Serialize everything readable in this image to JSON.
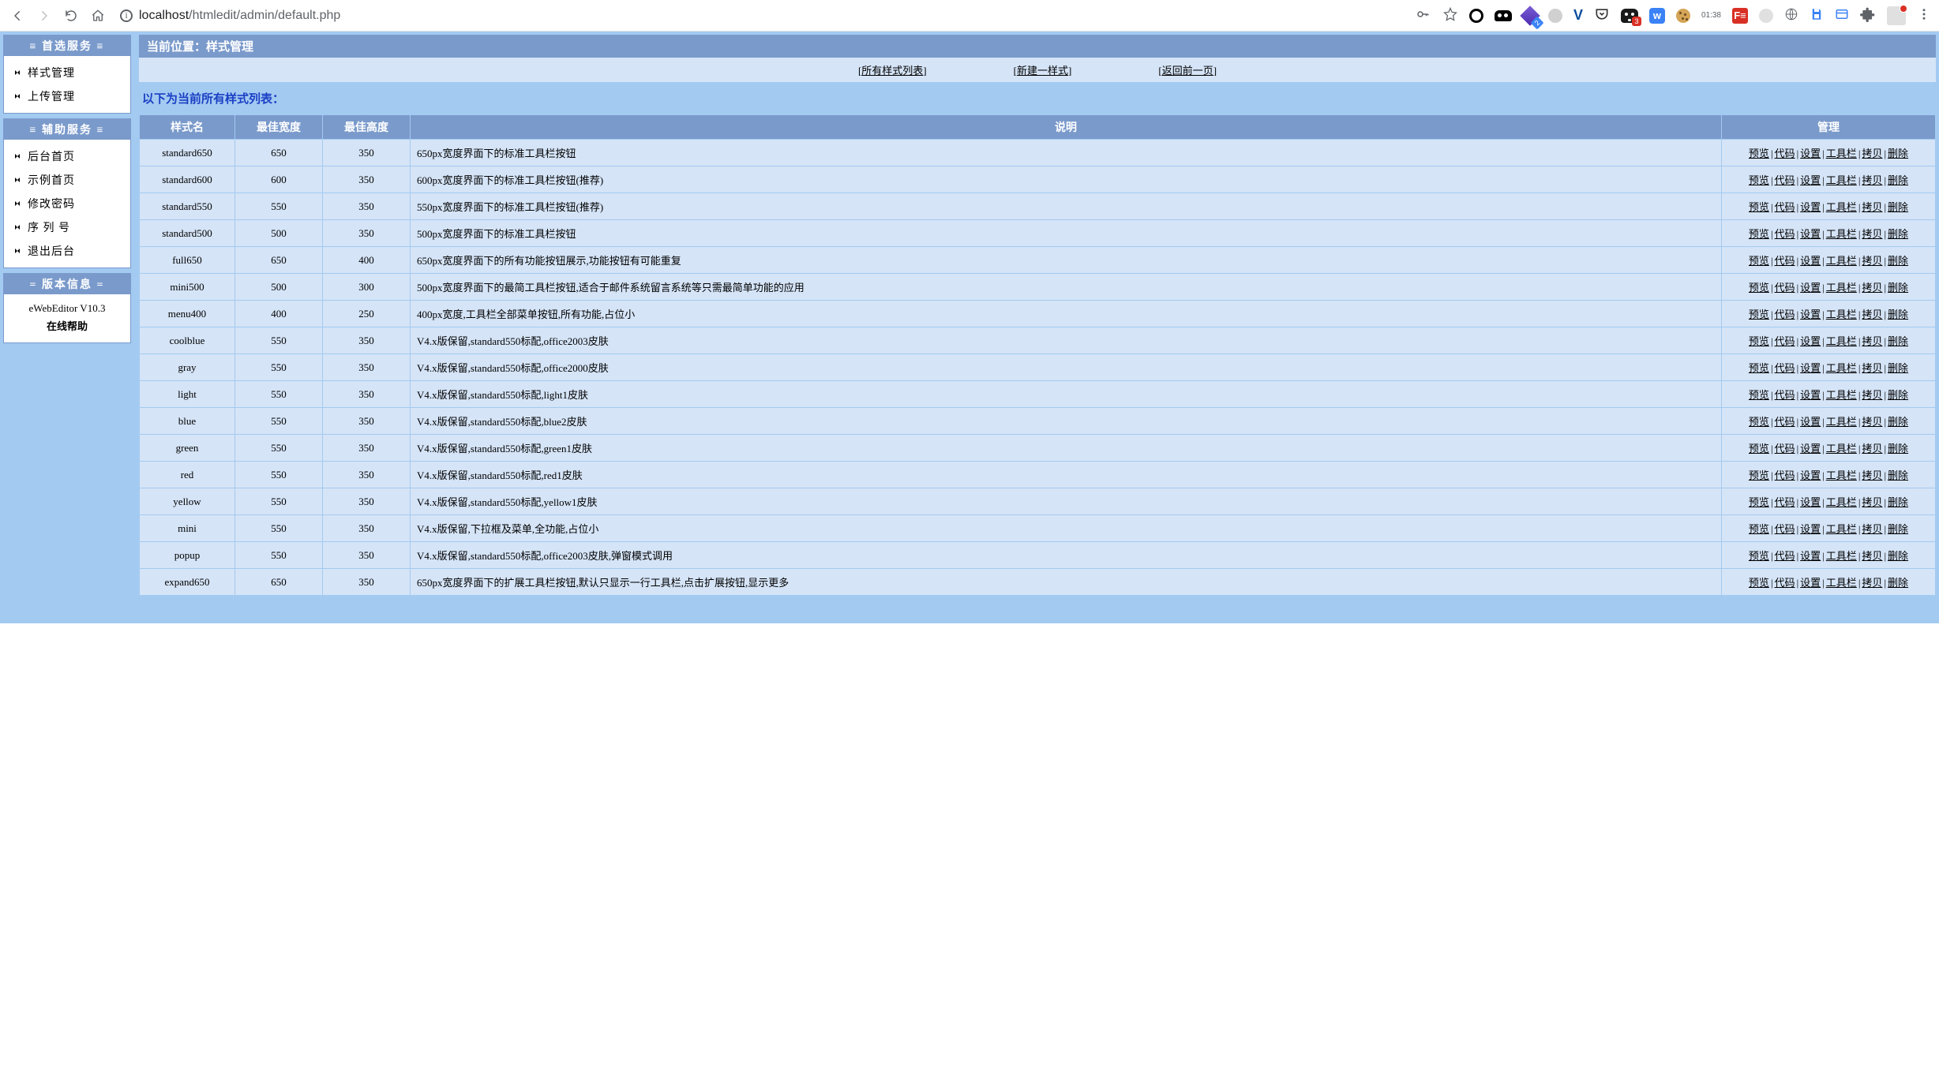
{
  "browser": {
    "url_host": "localhost",
    "url_path": "/htmledit/admin/default.php",
    "time": "01:38",
    "dog_badge": "3",
    "diamond_badge": "2"
  },
  "sidebar": {
    "panels": [
      {
        "title_text": "≡ 首选服务 ≡",
        "items": [
          {
            "label": "样式管理"
          },
          {
            "label": "上传管理"
          }
        ]
      },
      {
        "title_text": "≡ 辅助服务 ≡",
        "items": [
          {
            "label": "后台首页"
          },
          {
            "label": "示例首页"
          },
          {
            "label": "修改密码"
          },
          {
            "label": "序 列 号"
          },
          {
            "label": "退出后台"
          }
        ]
      }
    ],
    "version": {
      "title_text": "= 版本信息 =",
      "version_line": "eWebEditor V10.3",
      "help_line": "在线帮助"
    }
  },
  "breadcrumb": "当前位置：样式管理",
  "actions": {
    "all_list": "所有样式列表",
    "create_new": "新建一样式",
    "go_back": "返回前一页"
  },
  "list_title": "以下为当前所有样式列表：",
  "table": {
    "headers": {
      "name": "样式名",
      "width": "最佳宽度",
      "height": "最佳高度",
      "desc": "说明",
      "manage": "管理"
    },
    "ops": {
      "preview": "预览",
      "code": "代码",
      "settings": "设置",
      "toolbar": "工具栏",
      "copy": "拷贝",
      "delete": "删除"
    },
    "rows": [
      {
        "name": "standard650",
        "width": "650",
        "height": "350",
        "desc": "650px宽度界面下的标准工具栏按钮"
      },
      {
        "name": "standard600",
        "width": "600",
        "height": "350",
        "desc": "600px宽度界面下的标准工具栏按钮(推荐)"
      },
      {
        "name": "standard550",
        "width": "550",
        "height": "350",
        "desc": "550px宽度界面下的标准工具栏按钮(推荐)"
      },
      {
        "name": "standard500",
        "width": "500",
        "height": "350",
        "desc": "500px宽度界面下的标准工具栏按钮"
      },
      {
        "name": "full650",
        "width": "650",
        "height": "400",
        "desc": "650px宽度界面下的所有功能按钮展示,功能按钮有可能重复"
      },
      {
        "name": "mini500",
        "width": "500",
        "height": "300",
        "desc": "500px宽度界面下的最简工具栏按钮,适合于邮件系统留言系统等只需最简单功能的应用"
      },
      {
        "name": "menu400",
        "width": "400",
        "height": "250",
        "desc": "400px宽度,工具栏全部菜单按钮,所有功能,占位小"
      },
      {
        "name": "coolblue",
        "width": "550",
        "height": "350",
        "desc": "V4.x版保留,standard550标配,office2003皮肤"
      },
      {
        "name": "gray",
        "width": "550",
        "height": "350",
        "desc": "V4.x版保留,standard550标配,office2000皮肤"
      },
      {
        "name": "light",
        "width": "550",
        "height": "350",
        "desc": "V4.x版保留,standard550标配,light1皮肤"
      },
      {
        "name": "blue",
        "width": "550",
        "height": "350",
        "desc": "V4.x版保留,standard550标配,blue2皮肤"
      },
      {
        "name": "green",
        "width": "550",
        "height": "350",
        "desc": "V4.x版保留,standard550标配,green1皮肤"
      },
      {
        "name": "red",
        "width": "550",
        "height": "350",
        "desc": "V4.x版保留,standard550标配,red1皮肤"
      },
      {
        "name": "yellow",
        "width": "550",
        "height": "350",
        "desc": "V4.x版保留,standard550标配,yellow1皮肤"
      },
      {
        "name": "mini",
        "width": "550",
        "height": "350",
        "desc": "V4.x版保留,下拉框及菜单,全功能,占位小"
      },
      {
        "name": "popup",
        "width": "550",
        "height": "350",
        "desc": "V4.x版保留,standard550标配,office2003皮肤,弹窗模式调用"
      },
      {
        "name": "expand650",
        "width": "650",
        "height": "350",
        "desc": "650px宽度界面下的扩展工具栏按钮,默认只显示一行工具栏,点击扩展按钮,显示更多"
      }
    ]
  }
}
